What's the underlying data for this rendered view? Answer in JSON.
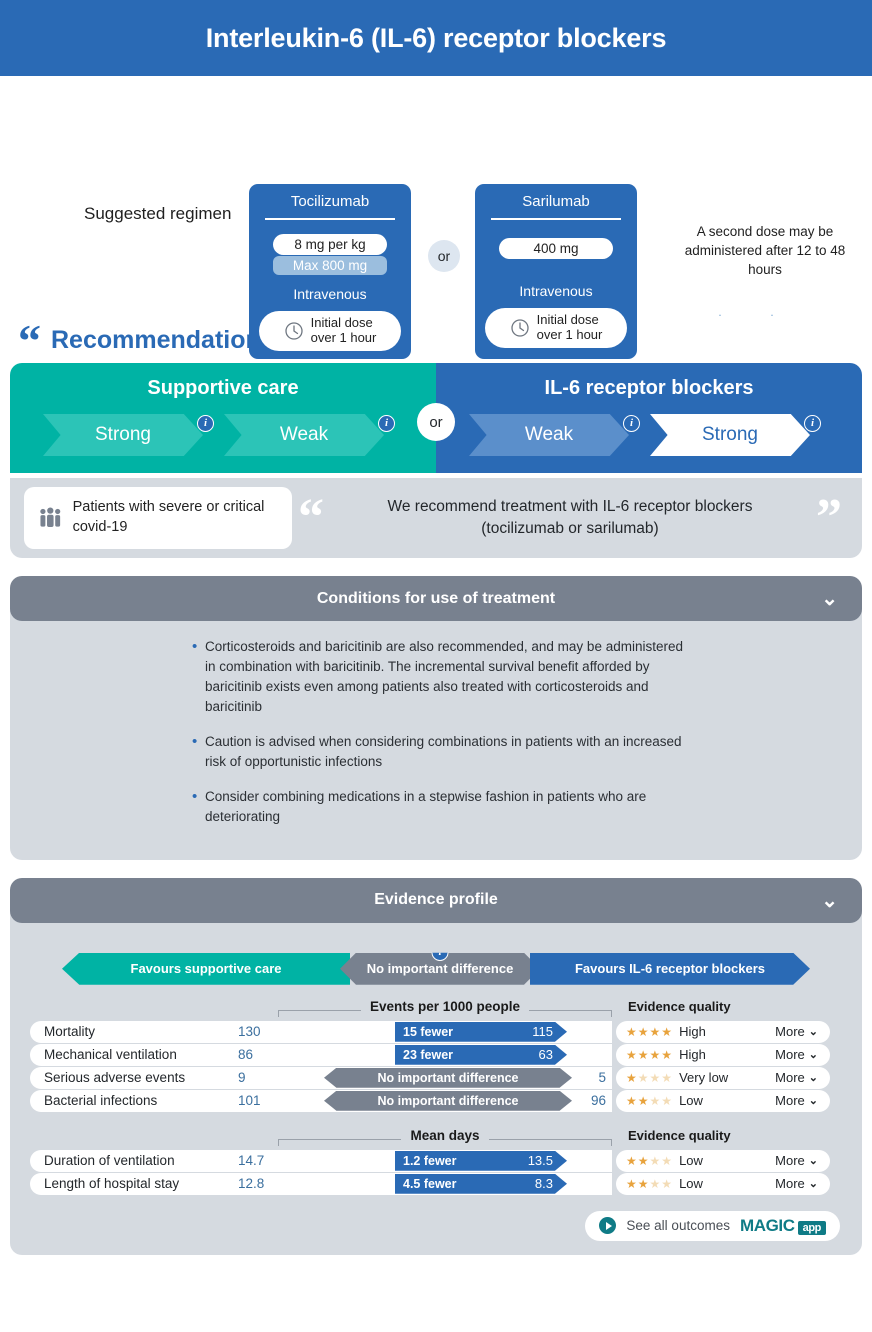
{
  "title": "Interleukin-6 (IL-6) receptor blockers",
  "regimen": {
    "label": "Suggested regimen",
    "or": "or",
    "drugs": [
      {
        "name": "Tocilizumab",
        "dose": "8 mg per kg",
        "max": "Max 800 mg",
        "route": "Intravenous",
        "infusion": "Initial dose",
        "infusion2": "over 1 hour",
        "clock_icon": "clock-icon"
      },
      {
        "name": "Sarilumab",
        "dose": "400 mg",
        "max": "",
        "route": "Intravenous",
        "infusion": "Initial dose",
        "infusion2": "over 1 hour",
        "clock_icon": "clock-icon"
      }
    ],
    "second_dose_note": "A second dose may be administered after 12 to 48 hours"
  },
  "recommendation": {
    "heading": "Recommendation",
    "quote_icon": "quote-icon",
    "or": "or",
    "left": {
      "title": "Supportive care",
      "options": [
        {
          "label": "Strong",
          "selected": false
        },
        {
          "label": "Weak",
          "selected": false
        }
      ]
    },
    "right": {
      "title": "IL-6 receptor blockers",
      "options": [
        {
          "label": "Weak",
          "selected": false
        },
        {
          "label": "Strong",
          "selected": true
        }
      ]
    },
    "info_icon": "info-icon",
    "population_icon": "people-icon",
    "population": "Patients with severe or critical covid-19",
    "statement_line1": "We recommend treatment with IL-6 receptor blockers",
    "statement_line2": "(tocilizumab or sarilumab)"
  },
  "conditions": {
    "heading": "Conditions for use of treatment",
    "chevron_icon": "chevron-down-icon",
    "bullets": [
      "Corticosteroids and baricitinib are also recommended, and may be administered in combination with baricitinib. The incremental survival benefit afforded by baricitinib exists even among patients also treated with corticosteroids and baricitinib",
      "Caution is advised when considering combinations in patients with an increased risk of opportunistic infections",
      "Consider combining medications in a stepwise fashion in patients who are deteriorating"
    ]
  },
  "evidence": {
    "heading": "Evidence profile",
    "chevron_icon": "chevron-down-icon",
    "direction": {
      "left": "Favours supportive care",
      "middle": "No important difference",
      "right": "Favours IL-6 receptor blockers",
      "info_icon": "info-icon"
    },
    "group1_title": "Events per 1000 people",
    "group2_title": "Mean days",
    "quality_header": "Evidence quality",
    "more_label": "More",
    "more_icon": "chevron-down-icon",
    "footer": {
      "see_all": "See all outcomes",
      "play_icon": "play-icon",
      "brand": "MAGIC",
      "brand_suffix": "app"
    }
  },
  "chart_data": {
    "type": "table",
    "title": "Evidence profile",
    "groups": [
      {
        "unit": "Events per 1000 people",
        "rows": [
          {
            "outcome": "Mortality",
            "control": "130",
            "effect": "15 fewer",
            "intervention": "115",
            "direction": "favours-intervention",
            "quality": "High",
            "stars": 4,
            "more": "More"
          },
          {
            "outcome": "Mechanical ventilation",
            "control": "86",
            "effect": "23 fewer",
            "intervention": "63",
            "direction": "favours-intervention",
            "quality": "High",
            "stars": 4,
            "more": "More"
          },
          {
            "outcome": "Serious adverse events",
            "control": "9",
            "effect": "No important difference",
            "intervention": "5",
            "direction": "no-difference",
            "quality": "Very low",
            "stars": 1,
            "more": "More"
          },
          {
            "outcome": "Bacterial infections",
            "control": "101",
            "effect": "No important difference",
            "intervention": "96",
            "direction": "no-difference",
            "quality": "Low",
            "stars": 2,
            "more": "More"
          }
        ]
      },
      {
        "unit": "Mean days",
        "rows": [
          {
            "outcome": "Duration of ventilation",
            "control": "14.7",
            "effect": "1.2 fewer",
            "intervention": "13.5",
            "direction": "favours-intervention",
            "quality": "Low",
            "stars": 2,
            "more": "More"
          },
          {
            "outcome": "Length of hospital stay",
            "control": "12.8",
            "effect": "4.5 fewer",
            "intervention": "8.3",
            "direction": "favours-intervention",
            "quality": "Low",
            "stars": 2,
            "more": "More"
          }
        ]
      }
    ]
  },
  "colors": {
    "brand_blue": "#2a6ab5",
    "teal": "#00b3a4",
    "grey": "#78818f",
    "panel_bg": "#d5dae0",
    "star": "#e8a33d",
    "magic_teal": "#0f7b86"
  }
}
